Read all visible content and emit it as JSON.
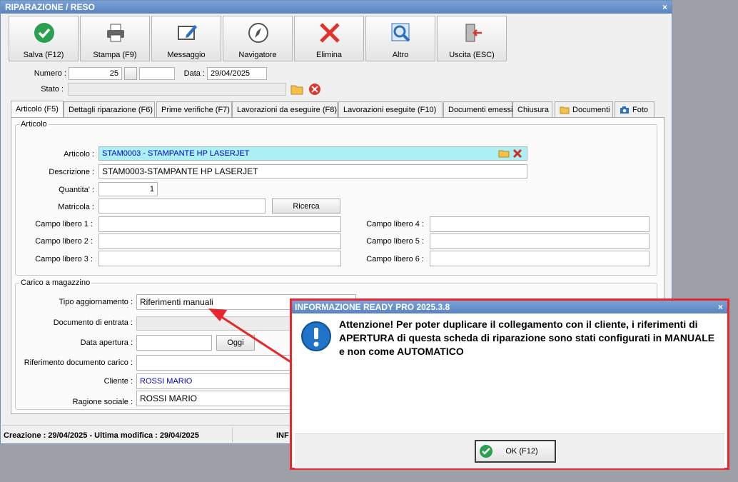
{
  "window": {
    "title": "RIPARAZIONE / RESO",
    "close": "×"
  },
  "toolbar": [
    {
      "label": "Salva (F12)",
      "icon": "check-circle-icon"
    },
    {
      "label": "Stampa (F9)",
      "icon": "printer-icon"
    },
    {
      "label": "Messaggio",
      "icon": "message-edit-icon"
    },
    {
      "label": "Navigatore",
      "icon": "compass-icon"
    },
    {
      "label": "Elimina",
      "icon": "delete-x-icon"
    },
    {
      "label": "Altro",
      "icon": "magnifier-icon"
    },
    {
      "label": "Uscita (ESC)",
      "icon": "exit-door-icon"
    }
  ],
  "header": {
    "numero_label": "Numero :",
    "numero_value": "25",
    "numero_suffix": "",
    "data_label": "Data :",
    "data_value": "29/04/2025",
    "stato_label": "Stato :",
    "stato_value": ""
  },
  "tabs": [
    "Articolo (F5)",
    "Dettagli riparazione (F6)",
    "Prime verifiche (F7)",
    "Lavorazioni da eseguire (F8)",
    "Lavorazioni eseguite  (F10)",
    "Documenti emessi",
    "Chiusura",
    "Documenti",
    "Foto"
  ],
  "articolo": {
    "group_title": "Articolo",
    "articolo_label": "Articolo :",
    "articolo_value": "STAM0003 - STAMPANTE HP LASERJET",
    "descrizione_label": "Descrizione :",
    "descrizione_value": "STAM0003-STAMPANTE HP LASERJET",
    "quantita_label": "Quantita' :",
    "quantita_value": "1",
    "matricola_label": "Matricola :",
    "matricola_value": "",
    "ricerca_label": "Ricerca",
    "campi": [
      "Campo libero 1 :",
      "Campo libero 2 :",
      "Campo libero 3 :",
      "Campo libero 4 :",
      "Campo libero 5 :",
      "Campo libero 6 :"
    ]
  },
  "carico": {
    "group_title": "Carico a magazzino",
    "tipo_label": "Tipo aggiornamento :",
    "tipo_value": "Riferimenti manuali",
    "documento_label": "Documento di entrata :",
    "data_apertura_label": "Data apertura :",
    "oggi_label": "Oggi",
    "riferimento_label": "Riferimento documento carico :",
    "cliente_label": "Cliente :",
    "cliente_value": "ROSSI MARIO",
    "ragione_label": "Ragione sociale :",
    "ragione_value": "ROSSI MARIO"
  },
  "status": {
    "text": "Creazione : 29/04/2025 - Ultima modifica : 29/04/2025",
    "extra": "INF"
  },
  "dialog": {
    "title": "INFORMAZIONE READY PRO 2025.3.8",
    "close": "×",
    "message": "Attenzione! Per poter duplicare il collegamento con il cliente, i riferimenti di APERTURA di questa scheda di riparazione sono stati configurati in MANUALE e non come AUTOMATICO",
    "ok_label": "OK (F12)"
  },
  "colors": {
    "accent": "#e8262b",
    "field_highlight": "#aaf0f4",
    "link_text": "#0000c8"
  }
}
